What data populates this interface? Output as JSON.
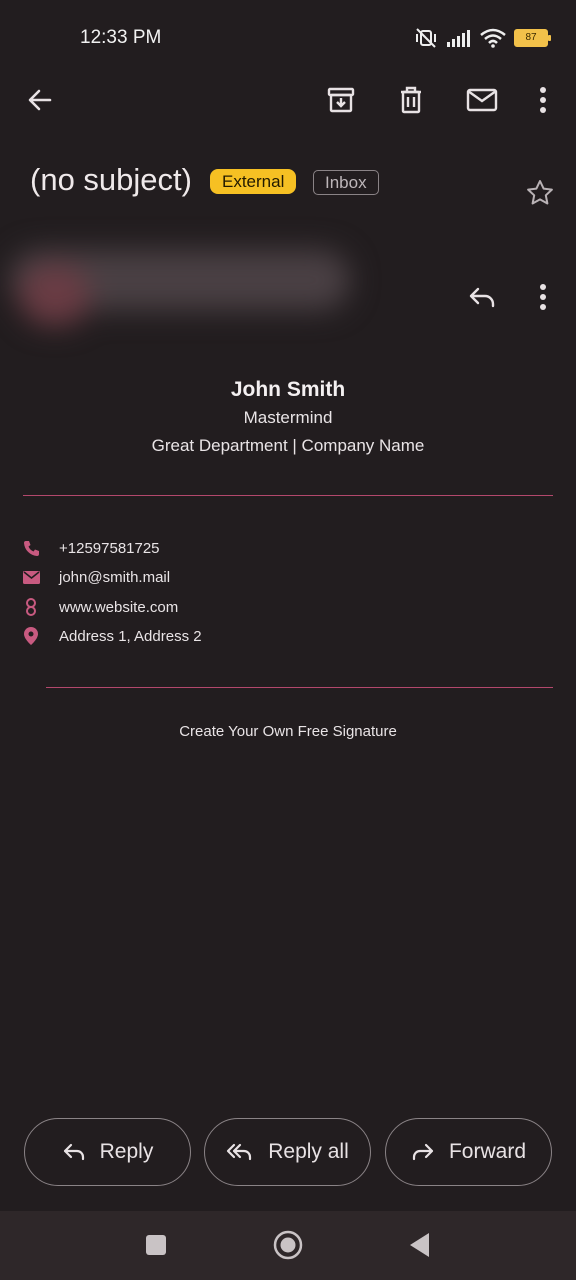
{
  "status_bar": {
    "time": "12:33 PM",
    "battery": "87"
  },
  "toolbar": {
    "back_icon": "arrow-left-icon",
    "archive_icon": "archive-icon",
    "delete_icon": "trash-icon",
    "mark_unread_icon": "mail-icon",
    "more_icon": "more-vertical-icon"
  },
  "email": {
    "subject": "(no subject)",
    "label_external": "External",
    "label_inbox": "Inbox"
  },
  "signature": {
    "name": "John Smith",
    "title": "Mastermind",
    "department": "Great Department | Company Name",
    "phone": "+12597581725",
    "email": "john@smith.mail",
    "website": "www.website.com",
    "address": "Address 1, Address 2",
    "create_link": "Create Your Own Free Signature"
  },
  "actions": {
    "reply": "Reply",
    "reply_all": "Reply all",
    "forward": "Forward"
  },
  "colors": {
    "background": "#221d1f",
    "accent_external": "#f6c023",
    "divider": "#b3486c",
    "icon_pink": "#c85a80"
  }
}
